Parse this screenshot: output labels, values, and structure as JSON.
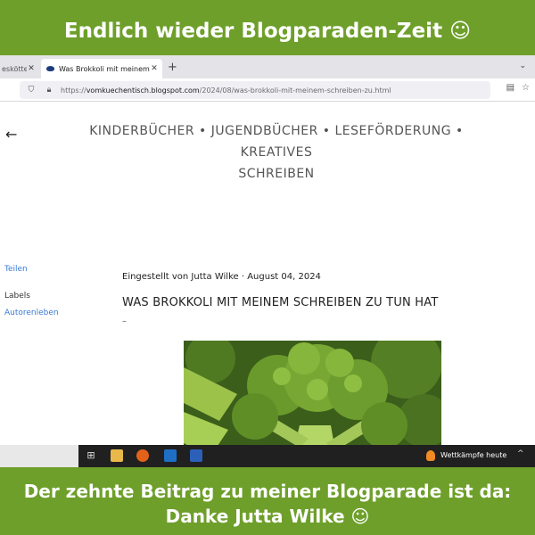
{
  "banner": {
    "top_text": "Endlich wieder Blogparaden-Zeit ☺",
    "bottom_line1": "Der zehnte Beitrag zu meiner Blogparade ist da:",
    "bottom_line2": "Danke Jutta Wilke ☺"
  },
  "browser": {
    "prev_tab": "eskötter -",
    "active_tab": "Was Brokkoli mit meinem Schre",
    "url_host": "vomkuechentisch.blogspot.com",
    "url_prefix": "https://",
    "url_path": "/2024/08/was-brokkoli-mit-meinem-schreiben-zu.html"
  },
  "blog": {
    "header_line1": "KINDERBÜCHER • JUGENDBÜCHER • LESEFÖRDERUNG • KREATIVES",
    "header_line2": "SCHREIBEN",
    "sidebar": {
      "share": "Teilen",
      "labels": "Labels",
      "author_life": "Autorenleben"
    },
    "meta": "Eingestellt von Jutta Wilke · August 04, 2024",
    "title": "WAS BROKKOLI MIT MEINEM SCHREIBEN ZU TUN HAT",
    "dash": "–"
  },
  "taskbar": {
    "weather_text": "Wettkämpfe heute"
  },
  "colors": {
    "banner_green": "#6e9f2a",
    "link_blue": "#3a7bd5"
  }
}
